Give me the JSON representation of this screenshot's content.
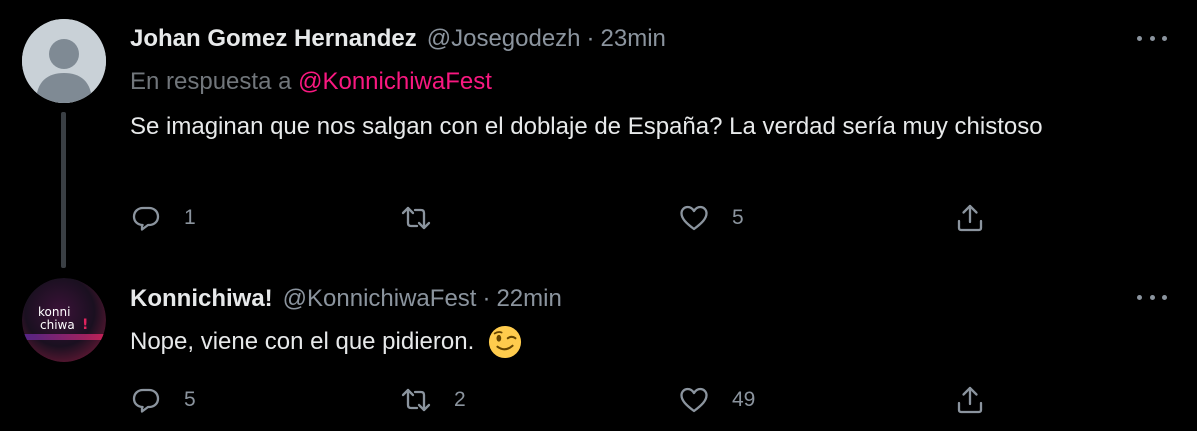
{
  "tweets": [
    {
      "author_name": "Johan Gomez Hernandez",
      "handle": "@Josegodezh",
      "separator": "·",
      "time": "23min",
      "reply_prefix": "En respuesta a",
      "reply_mention": "@KonnichiwaFest",
      "text": "Se imaginan que nos salgan con el doblaje de España? La verdad sería muy chistoso",
      "reply_count": "1",
      "retweet_count": "",
      "like_count": "5",
      "avatar": "default-profile-icon"
    },
    {
      "author_name": "Konnichiwa!",
      "handle": "@KonnichiwaFest",
      "separator": "·",
      "time": "22min",
      "text": "Nope, viene con el que pidieron.",
      "emoji": "winking-face",
      "reply_count": "5",
      "retweet_count": "2",
      "like_count": "49",
      "avatar_logo_text": "konni chiwa!"
    }
  ],
  "colors": {
    "background": "#000000",
    "mention": "#f91880",
    "muted": "#8b949e",
    "text": "#e7e9ea",
    "thread_line": "#3a3f44"
  }
}
